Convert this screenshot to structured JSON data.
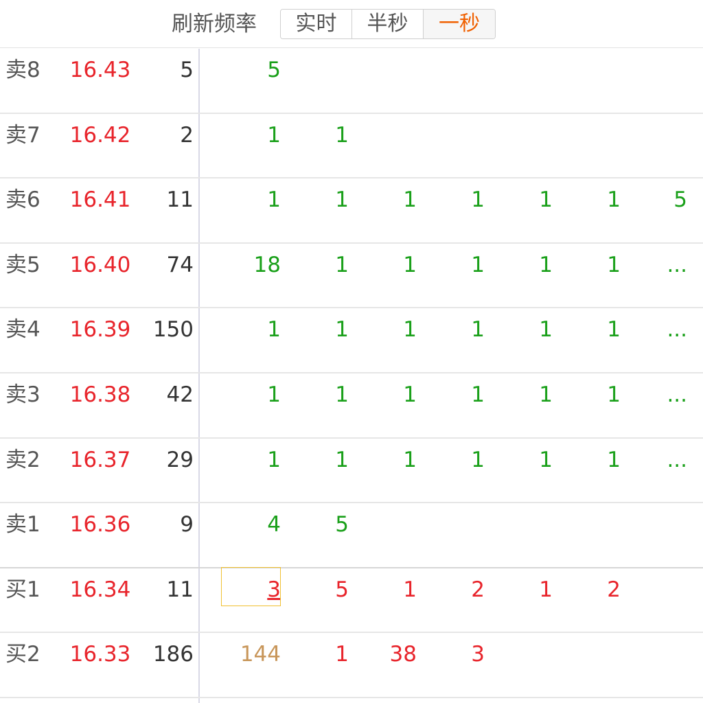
{
  "header": {
    "label": "刷新频率",
    "options": [
      {
        "label": "实时",
        "active": false,
        "color": "#555555"
      },
      {
        "label": "半秒",
        "active": false,
        "color": "#555555"
      },
      {
        "label": "一秒",
        "active": true,
        "color": "#f06000"
      }
    ]
  },
  "colors": {
    "sell_qty": "#1aa01a",
    "buy_qty": "#e8242b",
    "price": "#e8242b",
    "large_qty": "#c8965a",
    "highlight_border": "#f0c030"
  },
  "rows": [
    {
      "label": "卖8",
      "price": "16.43",
      "volume": "5",
      "side": "sell",
      "qty": [
        "5"
      ]
    },
    {
      "label": "卖7",
      "price": "16.42",
      "volume": "2",
      "side": "sell",
      "qty": [
        "1",
        "1"
      ]
    },
    {
      "label": "卖6",
      "price": "16.41",
      "volume": "11",
      "side": "sell",
      "qty": [
        "1",
        "1",
        "1",
        "1",
        "1",
        "1",
        "5"
      ]
    },
    {
      "label": "卖5",
      "price": "16.40",
      "volume": "74",
      "side": "sell",
      "qty": [
        "18",
        "1",
        "1",
        "1",
        "1",
        "1",
        "..."
      ]
    },
    {
      "label": "卖4",
      "price": "16.39",
      "volume": "150",
      "side": "sell",
      "qty": [
        "1",
        "1",
        "1",
        "1",
        "1",
        "1",
        "..."
      ]
    },
    {
      "label": "卖3",
      "price": "16.38",
      "volume": "42",
      "side": "sell",
      "qty": [
        "1",
        "1",
        "1",
        "1",
        "1",
        "1",
        "..."
      ]
    },
    {
      "label": "卖2",
      "price": "16.37",
      "volume": "29",
      "side": "sell",
      "qty": [
        "1",
        "1",
        "1",
        "1",
        "1",
        "1",
        "..."
      ]
    },
    {
      "label": "卖1",
      "price": "16.36",
      "volume": "9",
      "side": "sell",
      "qty": [
        "4",
        "5"
      ]
    },
    {
      "label": "买1",
      "price": "16.34",
      "volume": "11",
      "side": "buy",
      "qty": [
        "3",
        "5",
        "1",
        "2",
        "1",
        "2"
      ],
      "highlight_index": 0
    },
    {
      "label": "买2",
      "price": "16.33",
      "volume": "186",
      "side": "buy",
      "qty": [
        "144",
        "1",
        "38",
        "3"
      ],
      "large_index": 0
    }
  ]
}
